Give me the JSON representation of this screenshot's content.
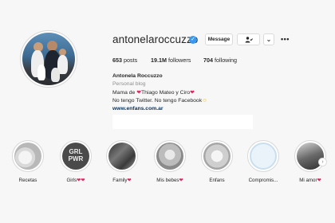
{
  "profile": {
    "username": "antonelaroccuzzo",
    "verified_mark": "✓",
    "buttons": {
      "message": "Message",
      "follow_icon": "person-check-icon",
      "chevron": "⌄",
      "more": "•••"
    },
    "stats": {
      "posts_count": "653",
      "posts_label": "posts",
      "followers_count": "19.1M",
      "followers_label": "followers",
      "following_count": "704",
      "following_label": "following"
    },
    "bio": {
      "name": "Antonela Roccuzzo",
      "category": "Personal blog",
      "line1_a": "Mama de ",
      "line1_b": "Thiago Mateo y Ciro",
      "line2": "No tengo Twitter. No tengo Facebook",
      "link": "www.enfans.com.ar"
    }
  },
  "highlights": [
    {
      "label": "Recetas"
    },
    {
      "label": "Girls"
    },
    {
      "label": "Family"
    },
    {
      "label": "Mis bebes"
    },
    {
      "label": "Enfans"
    },
    {
      "label": "Compromis..."
    },
    {
      "label": "Mi amor"
    }
  ],
  "icons": {
    "heart": "❤",
    "smile": "☺",
    "next": "›"
  },
  "colors": {
    "background": "#f7f7f7",
    "verified": "#3897f0",
    "heart": "#e0245e",
    "link": "#00376b",
    "muted": "#8e8e8e"
  }
}
